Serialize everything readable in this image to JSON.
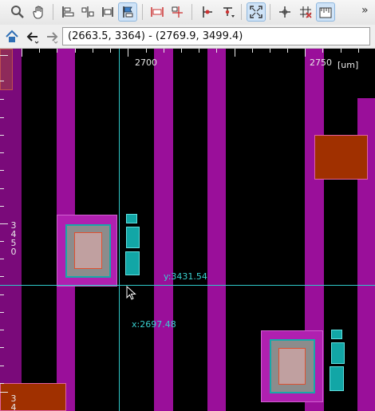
{
  "toolbar": {
    "buttons": [
      {
        "icon": "zoom-icon"
      },
      {
        "icon": "pan-hand-icon"
      },
      {
        "icon": "align-left-icon"
      },
      {
        "icon": "distribute-icon"
      },
      {
        "icon": "align-width-icon"
      },
      {
        "icon": "flag-select-icon",
        "active": true
      },
      {
        "icon": "ruler-horizontal-icon"
      },
      {
        "icon": "marker-icon"
      },
      {
        "icon": "route-icon"
      },
      {
        "icon": "route-dropdown-icon"
      },
      {
        "icon": "fit-view-icon"
      },
      {
        "icon": "snap-icon"
      },
      {
        "icon": "grid-off-icon"
      },
      {
        "icon": "ruler-icon"
      }
    ],
    "overflow_label": "»"
  },
  "navbar": {
    "coordinate_range": "(2663.5, 3364) - (2769.9, 3499.4)"
  },
  "canvas": {
    "top_ruler": {
      "labels": [
        "2700",
        "2750"
      ],
      "unit": "[um]"
    },
    "left_ruler": {
      "labels": [
        {
          "chars": [
            "3",
            "4",
            "5",
            "0"
          ]
        },
        {
          "chars": [
            "3",
            "4"
          ]
        }
      ]
    },
    "cursor": {
      "x_label": "x:2697.48",
      "y_label": "y:3431.54"
    },
    "colors": {
      "background": "#000000",
      "metal": "#9a0f9a",
      "metal_light": "#c23ac2",
      "via_cyan": "#12a6a6",
      "via_inner_gray": "#8c8c8c",
      "orange_fill": "#a03000",
      "crosshair": "#2fc8c8"
    }
  }
}
